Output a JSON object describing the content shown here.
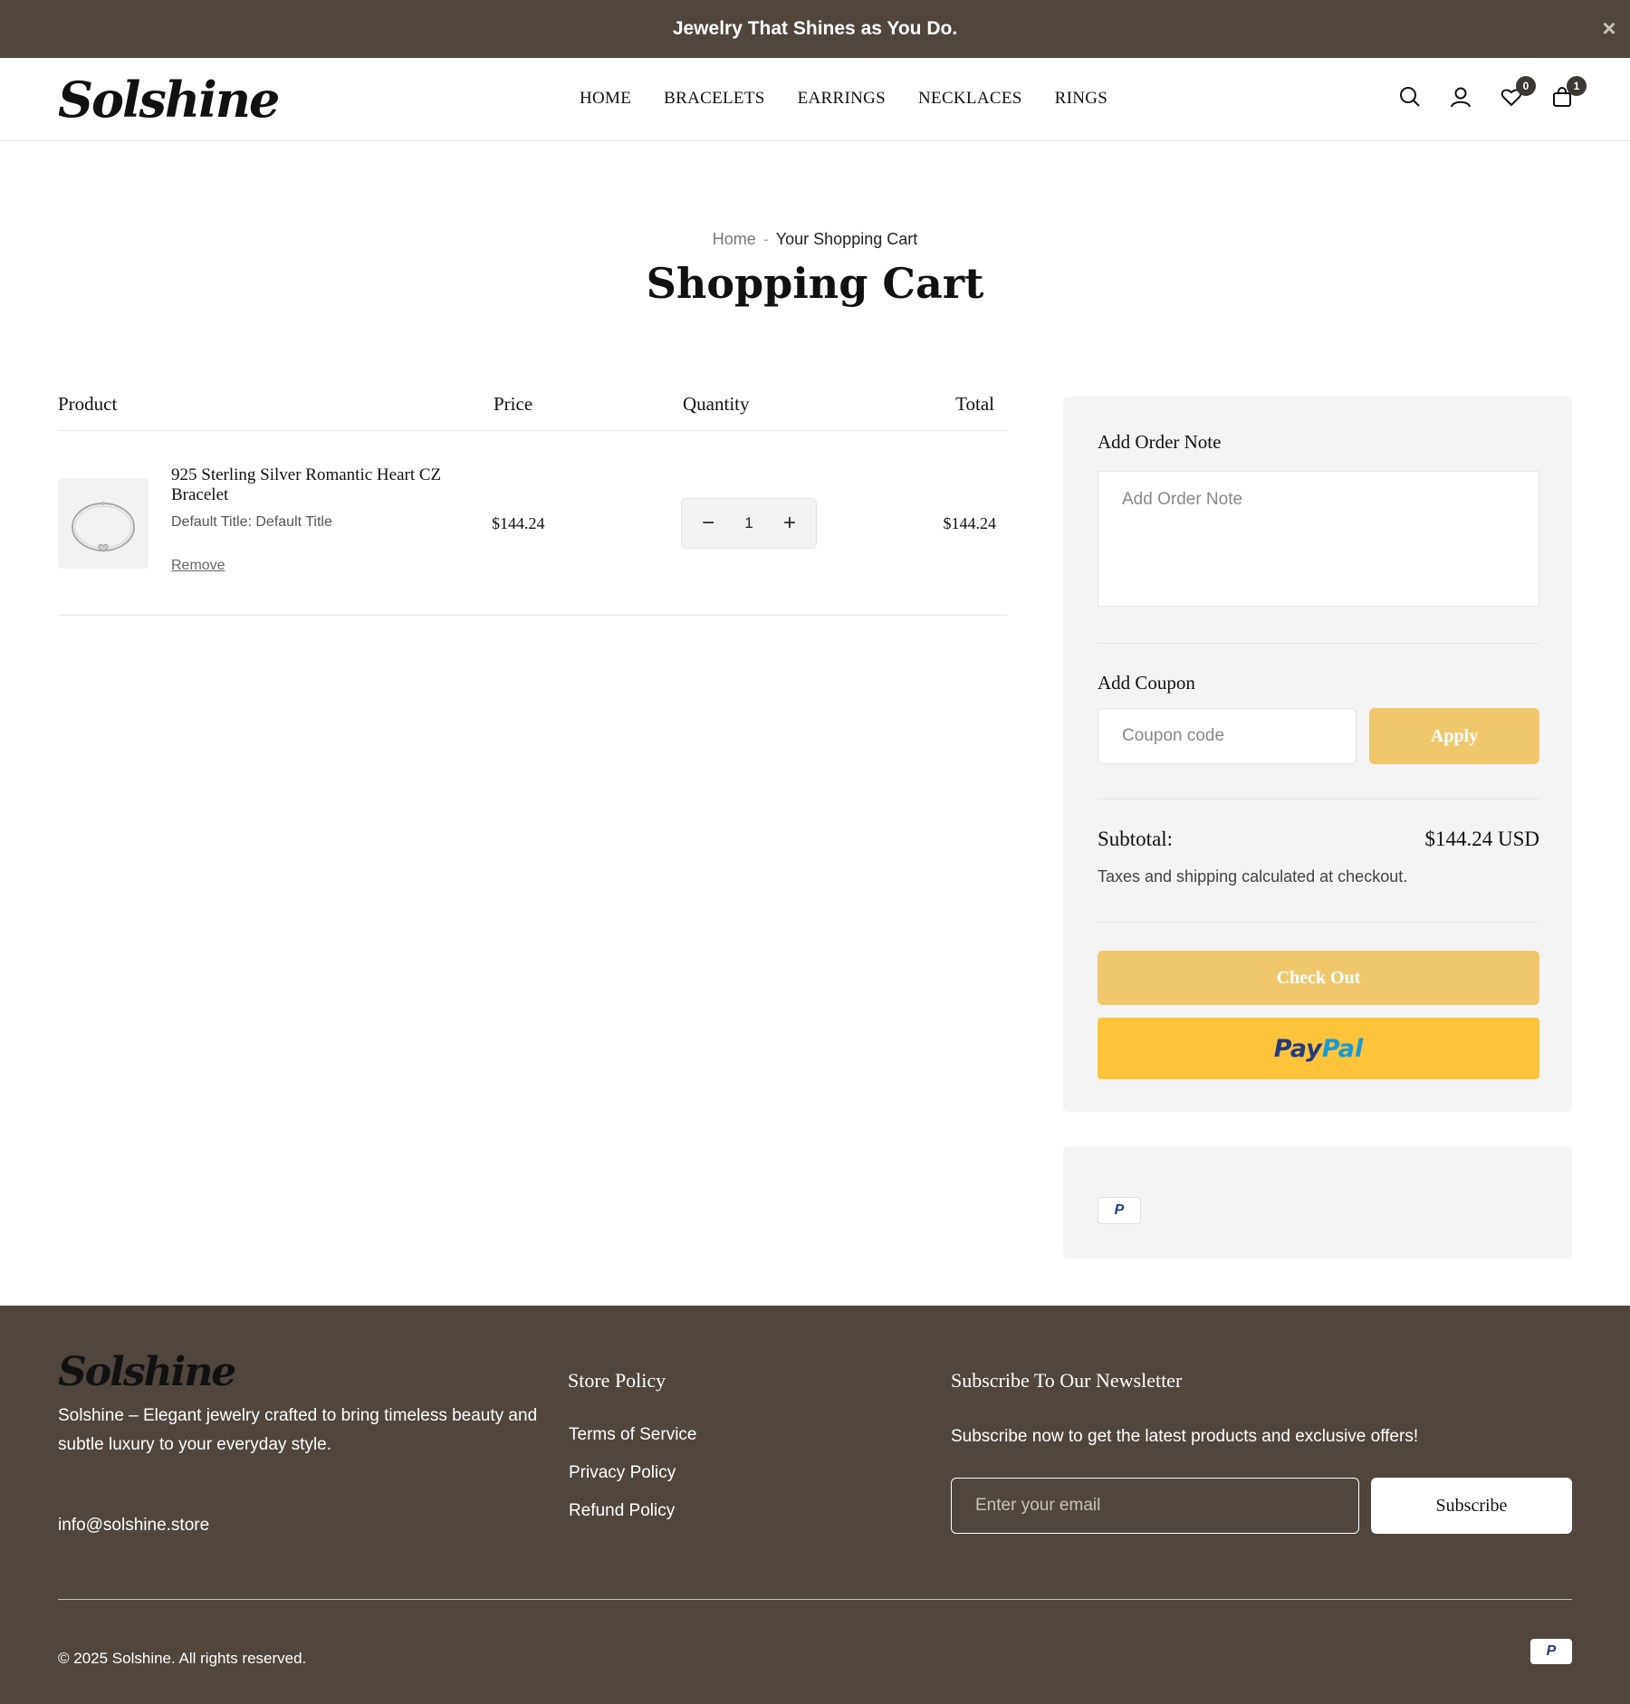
{
  "announcement": {
    "text": "Jewelry That Shines as You Do."
  },
  "header": {
    "logo": "Solshine",
    "nav": [
      "HOME",
      "BRACELETS",
      "EARRINGS",
      "NECKLACES",
      "RINGS"
    ],
    "wishlist_count": "0",
    "cart_count": "1"
  },
  "breadcrumb": {
    "home": "Home",
    "current": "Your Shopping Cart"
  },
  "page_title": "Shopping Cart",
  "cart": {
    "columns": {
      "product": "Product",
      "price": "Price",
      "quantity": "Quantity",
      "total": "Total"
    },
    "items": [
      {
        "name": "925 Sterling Silver Romantic Heart CZ Bracelet",
        "variant": "Default Title: Default Title",
        "remove_label": "Remove",
        "price": "$144.24",
        "quantity": "1",
        "total": "$144.24"
      }
    ]
  },
  "sidebar": {
    "order_note_label": "Add Order Note",
    "order_note_placeholder": "Add Order Note",
    "coupon_label": "Add Coupon",
    "coupon_placeholder": "Coupon code",
    "apply_label": "Apply",
    "subtotal_label": "Subtotal:",
    "subtotal_value": "$144.24 USD",
    "tax_note": "Taxes and shipping calculated at checkout.",
    "checkout_label": "Check Out",
    "paypal_part1": "Pay",
    "paypal_part2": "Pal",
    "accent_color": "#f1c76e"
  },
  "footer": {
    "logo": "Solshine",
    "description": "Solshine – Elegant jewelry crafted to bring timeless beauty and subtle luxury to your everyday style.",
    "email": "info@solshine.store",
    "policy_heading": "Store Policy",
    "policy_links": [
      "Terms of Service",
      "Privacy Policy",
      "Refund Policy"
    ],
    "newsletter_heading": "Subscribe To Our Newsletter",
    "newsletter_text": "Subscribe now to get the latest products and exclusive offers!",
    "email_placeholder": "Enter your email",
    "subscribe_label": "Subscribe",
    "copyright": "© 2025 Solshine. All rights reserved.",
    "background_color": "#50463e"
  }
}
